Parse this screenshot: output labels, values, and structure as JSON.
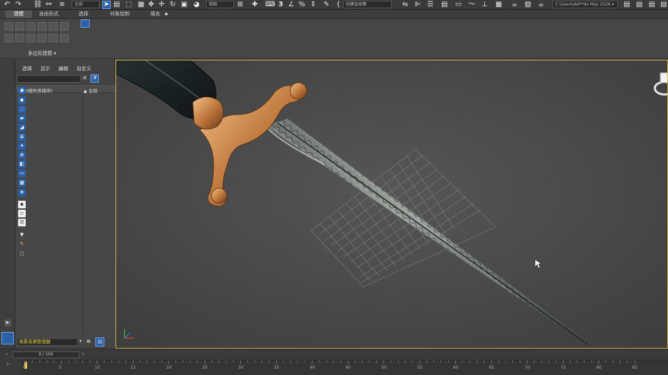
{
  "toolbar": {
    "dropdown_all": "全部",
    "dropdown_view": "视图",
    "dropdown_selection_set": "创建选择集",
    "path_field": "C:\\Users\\Ad**ds Max 2026 ▾"
  },
  "ribbon": {
    "tabs": [
      "建模",
      "自由形式",
      "选择",
      "对象绘制",
      "填充"
    ],
    "group_label": "多边形建模 ▾"
  },
  "scene_explorer": {
    "menu": [
      "选择",
      "显示",
      "编辑",
      "自定义"
    ],
    "columns": {
      "name": "名称(按升序排序)",
      "parent": "▲ 主结"
    }
  },
  "bottom": {
    "layer_field": "场景资源管理器",
    "frame_counter": "0 / 100",
    "timeline_ticks": [
      "0",
      "5",
      "10",
      "15",
      "20",
      "25",
      "30",
      "35",
      "40",
      "45",
      "50",
      "55",
      "60",
      "65",
      "70",
      "75",
      "80",
      "85"
    ]
  },
  "colors": {
    "accent": "#d5b04a",
    "active_blue": "#2b5fa8"
  }
}
